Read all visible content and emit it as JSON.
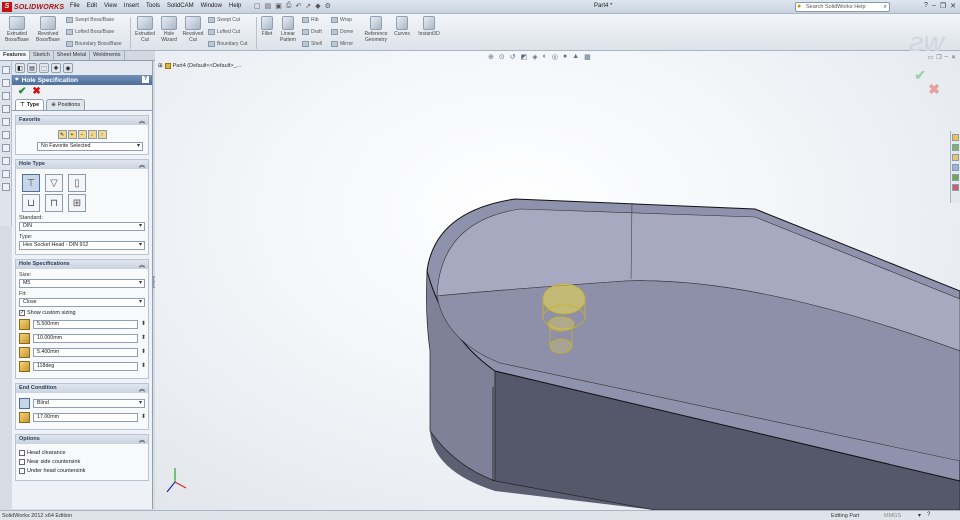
{
  "app": {
    "name": "SOLIDWORKS",
    "document_title": "Part4 *",
    "status_left": "SolidWorks 2012 x64 Edition",
    "status_mode": "Editing Part",
    "status_units": "MMGS"
  },
  "menu": [
    "File",
    "Edit",
    "View",
    "Insert",
    "Tools",
    "SolidCAM",
    "Window",
    "Help"
  ],
  "help_search": {
    "placeholder": "Search SolidWorks Help"
  },
  "commands": {
    "extruded_boss": "Extruded Boss/Base",
    "revolved_boss": "Revolved Boss/Base",
    "swept_boss": "Swept Boss/Base",
    "lofted_boss": "Lofted Boss/Base",
    "boundary_boss": "Boundary Boss/Base",
    "extruded_cut": "Extruded Cut",
    "hole_wizard": "Hole Wizard",
    "revolved_cut": "Revolved Cut",
    "swept_cut": "Swept Cut",
    "lofted_cut": "Lofted Cut",
    "boundary_cut": "Boundary Cut",
    "fillet": "Fillet",
    "linear_pattern": "Linear Pattern",
    "rib": "Rib",
    "draft": "Draft",
    "shell": "Shell",
    "wrap": "Wrap",
    "dome": "Dome",
    "mirror": "Mirror",
    "reference_geometry": "Reference Geometry",
    "curves": "Curves",
    "instant3d": "Instant3D"
  },
  "tabs": [
    "Features",
    "Sketch",
    "Sheet Metal",
    "Weldments"
  ],
  "property_manager": {
    "title": "Hole Specification",
    "subtabs": [
      "Type",
      "Positions"
    ],
    "favorite": {
      "heading": "Favorite",
      "selected": "No Favorite Selected"
    },
    "hole_type": {
      "heading": "Hole Type",
      "standard_label": "Standard:",
      "standard": "DIN",
      "type_label": "Type:",
      "type": "Hex Socket Head - DIN 912"
    },
    "hole_specs": {
      "heading": "Hole Specifications",
      "size_label": "Size:",
      "size": "M5",
      "fit_label": "Fit:",
      "fit": "Close",
      "custom_sizing_label": "Show custom sizing",
      "custom_sizing_checked": true,
      "values": [
        "5.500mm",
        "10.000mm",
        "5.400mm",
        "118deg"
      ]
    },
    "end_condition": {
      "heading": "End Condition",
      "condition": "Blind",
      "depth": "17.00mm"
    },
    "options": {
      "heading": "Options",
      "items": [
        "Head clearance",
        "Near side countersink",
        "Under head countersink"
      ]
    }
  },
  "tree": {
    "root": "Part4  (Default<<Default>_..."
  },
  "colors": {
    "accent": "#4e6f9c",
    "ok": "#1b8e2d",
    "cancel": "#cc1111",
    "part_face": "#8f92ad",
    "hole_preview": "#f0dc50"
  }
}
